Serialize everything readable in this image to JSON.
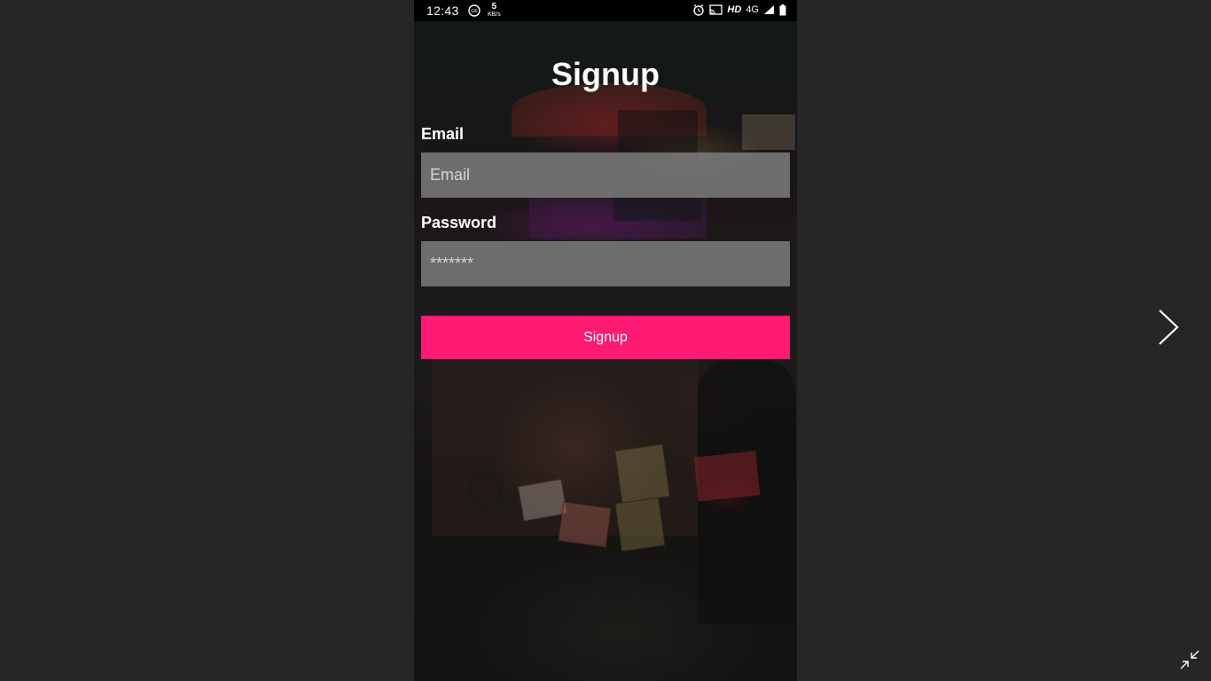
{
  "status_bar": {
    "time": "12:43",
    "speed_value": "5",
    "speed_unit": "KB/s",
    "network": "HD",
    "network_type": "4G"
  },
  "signup": {
    "title": "Signup",
    "email_label": "Email",
    "email_placeholder": "Email",
    "password_label": "Password",
    "password_placeholder": "*******",
    "button_label": "Signup"
  },
  "viewer": {
    "next_icon": "chevron-right-icon",
    "collapse_icon": "collapse-icon"
  },
  "colors": {
    "accent": "#ff1a74",
    "viewer_bg": "#262626",
    "input_bg": "#808080"
  }
}
